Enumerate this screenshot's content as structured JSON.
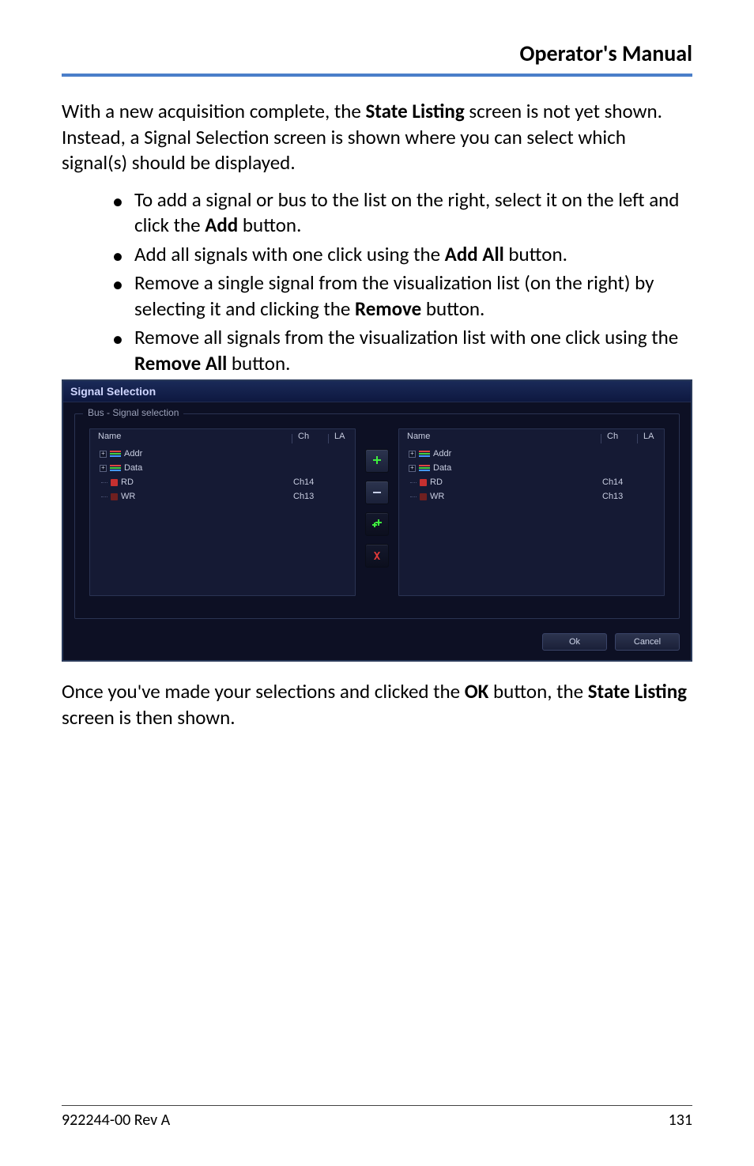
{
  "header": {
    "title": "Operator's Manual"
  },
  "intro": {
    "p1_a": "With a new acquisition complete, the ",
    "p1_b_bold": "State Listing",
    "p1_c": " screen is not yet shown. Instead, a Signal Selection screen is shown where you can select which signal(s) should be displayed."
  },
  "bullets": [
    {
      "a": "To add a signal or bus to the list on the right, select it on the left and click the ",
      "b_bold": "Add",
      "c": " button."
    },
    {
      "a": "Add all signals with one click using the ",
      "b_bold": "Add All",
      "c": " button."
    },
    {
      "a": "Remove a single signal from the visualization list (on the right) by selecting it and clicking the ",
      "b_bold": "Remove",
      "c": " button."
    },
    {
      "a": "Remove all signals from the visualization list with one click using the ",
      "b_bold": "Remove All",
      "c": " button."
    }
  ],
  "dialog": {
    "title": "Signal Selection",
    "legend": "Bus - Signal selection",
    "left": {
      "header": {
        "name": "Name",
        "ch": "Ch",
        "la": "LA"
      },
      "rows": [
        {
          "kind": "bus",
          "label": "Addr",
          "ch": "",
          "la": ""
        },
        {
          "kind": "bus",
          "label": "Data",
          "ch": "",
          "la": ""
        },
        {
          "kind": "sig",
          "label": "RD",
          "ch": "Ch14",
          "la": "",
          "color": "red"
        },
        {
          "kind": "sig",
          "label": "WR",
          "ch": "Ch13",
          "la": "",
          "color": "dkred"
        }
      ]
    },
    "right": {
      "header": {
        "name": "Name",
        "ch": "Ch",
        "la": "LA"
      },
      "rows": [
        {
          "kind": "bus",
          "label": "Addr",
          "ch": "",
          "la": ""
        },
        {
          "kind": "bus",
          "label": "Data",
          "ch": "",
          "la": ""
        },
        {
          "kind": "sig",
          "label": "RD",
          "ch": "Ch14",
          "la": "",
          "color": "red"
        },
        {
          "kind": "sig",
          "label": "WR",
          "ch": "Ch13",
          "la": "",
          "color": "dkred"
        }
      ]
    },
    "buttons": {
      "ok": "Ok",
      "cancel": "Cancel"
    }
  },
  "outro": {
    "a": "Once you've made your selections and clicked the ",
    "b_bold": "OK",
    "c": " button, the ",
    "d_bold": "State Listing",
    "e": " screen is then shown."
  },
  "footer": {
    "left": "922244-00 Rev A",
    "right": "131"
  }
}
